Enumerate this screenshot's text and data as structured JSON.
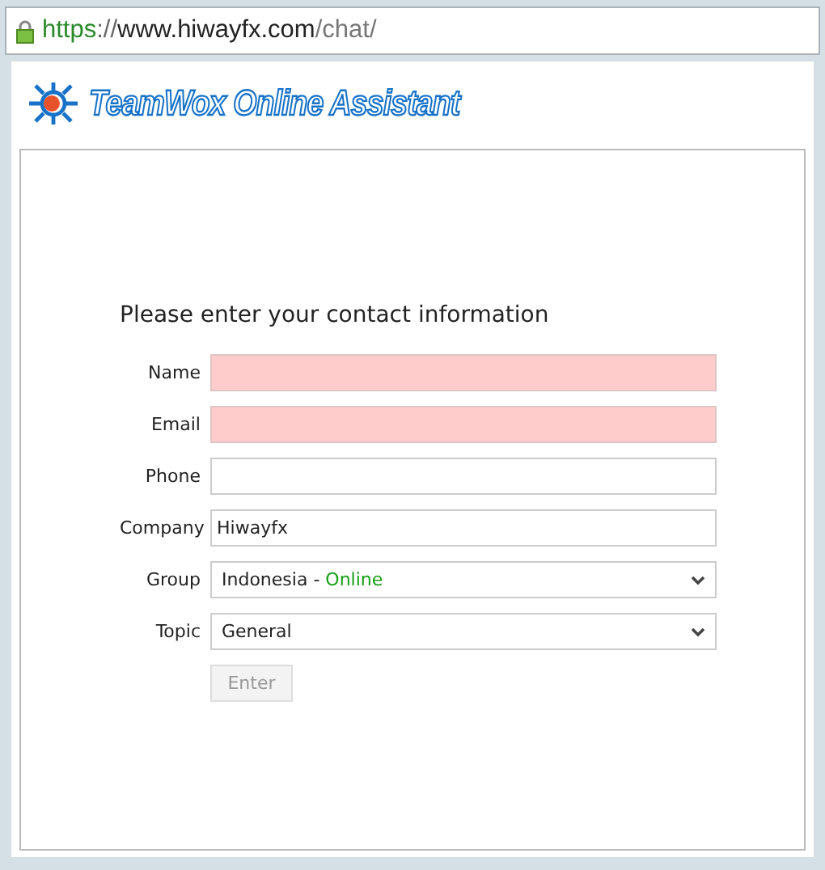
{
  "address_bar": {
    "scheme": "https",
    "separator": "://",
    "host": "www.hiwayfx.com",
    "path": "/chat/",
    "secure": true
  },
  "logo": {
    "title": "TeamWox Online Assistant"
  },
  "form": {
    "heading": "Please enter your contact information",
    "fields": [
      {
        "kind": "text",
        "label": "Name",
        "invalid": true
      },
      {
        "kind": "text",
        "label": "Email",
        "invalid": true
      },
      {
        "kind": "text",
        "label": "Phone",
        "invalid": false
      },
      {
        "kind": "text",
        "label": "Company",
        "value": "Hiwayfx",
        "invalid": false
      },
      {
        "kind": "select",
        "label": "Group",
        "value": "Indonesia - ",
        "status": "Online"
      },
      {
        "kind": "select",
        "label": "Topic",
        "value": "General"
      }
    ],
    "submit": {
      "label": "Enter",
      "disabled": true
    }
  }
}
